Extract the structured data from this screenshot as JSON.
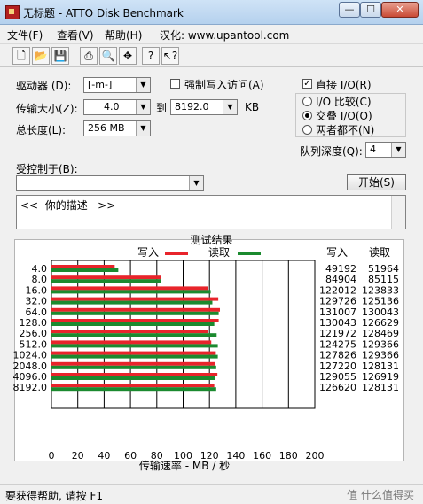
{
  "window": {
    "title": "无标题 - ATTO Disk Benchmark",
    "min_label": "—",
    "max_label": "☐",
    "close_label": "✕"
  },
  "menu": {
    "file": "文件(F)",
    "view": "查看(V)",
    "help": "帮助(H)",
    "localized": "汉化: www.upantool.com"
  },
  "toolbar": {
    "icons": [
      "new-icon",
      "open-icon",
      "save-icon",
      "print-icon",
      "print-preview-icon",
      "move-icon",
      "help-icon",
      "context-help-icon"
    ]
  },
  "form": {
    "drive_label": "驱动器 (D):",
    "drive_value": "[-m-]",
    "force_write_label": "强制写入访问(A)",
    "force_write_checked": false,
    "direct_io_label": "直接 I/O(R)",
    "direct_io_checked": true,
    "transfer_label": "传输大小(Z):",
    "transfer_from": "4.0",
    "to_label": "到",
    "transfer_to": "8192.0",
    "kb_label": "KB",
    "total_length_label": "总长度(L):",
    "total_length_value": "256 MB",
    "io_compare_label": "I/O 比较(C)",
    "overlapped_io_label": "交叠 I/O(O)",
    "neither_label": "两者都不(N)",
    "selected_io_mode": "overlapped",
    "queue_depth_label": "队列深度(Q):",
    "queue_depth_value": "4",
    "controlled_by_label": "受控制于(B):",
    "controlled_by_value": "",
    "start_label": "开始(S)",
    "description_text": "<<  你的描述   >>"
  },
  "results": {
    "title": "测试结果",
    "write_legend": "写入",
    "read_legend": "读取",
    "write_col": "写入",
    "read_col": "读取",
    "write_color": "#e8242b",
    "read_color": "#1b8a2f"
  },
  "chart_data": {
    "type": "bar",
    "orientation": "horizontal",
    "categories": [
      "4.0",
      "8.0",
      "16.0",
      "32.0",
      "64.0",
      "128.0",
      "256.0",
      "512.0",
      "1024.0",
      "2048.0",
      "4096.0",
      "8192.0"
    ],
    "series": [
      {
        "name": "写入",
        "values": [
          49192,
          84904,
          122012,
          129726,
          131007,
          130043,
          121972,
          124275,
          127826,
          127220,
          129055,
          126620
        ]
      },
      {
        "name": "读取",
        "values": [
          51964,
          85115,
          123833,
          125136,
          130043,
          126629,
          128469,
          129366,
          129366,
          128131,
          126919,
          128131
        ]
      }
    ],
    "xlabel": "传输速率 - MB / 秒",
    "xlim": [
      0,
      200
    ],
    "xticks": [
      "0",
      "20",
      "40",
      "60",
      "80",
      "100",
      "120",
      "140",
      "160",
      "180",
      "200"
    ],
    "grid": true,
    "legend_placement": "top"
  },
  "status": {
    "text": "要获得帮助, 请按 F1",
    "watermark": "值 什么值得买"
  }
}
